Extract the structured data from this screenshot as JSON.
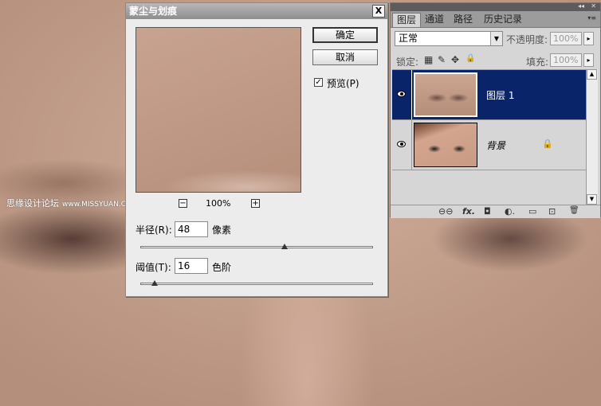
{
  "watermark": {
    "text": "思缘设计论坛",
    "url": "www.MISSYUAN.COM"
  },
  "dialog": {
    "title": "蒙尘与划痕",
    "close": "X",
    "ok": "确定",
    "cancel": "取消",
    "preview_checkbox": {
      "label": "预览(P)",
      "checked": true,
      "mark": "✓"
    },
    "zoom": {
      "minus": "−",
      "plus": "+",
      "level": "100%"
    },
    "radius": {
      "label": "半径(R):",
      "value": "48",
      "unit": "像素",
      "slider_fraction": 0.62
    },
    "threshold": {
      "label": "阈值(T):",
      "value": "16",
      "unit": "色阶",
      "slider_fraction": 0.06
    }
  },
  "panel": {
    "collapse_icon": "◂◂",
    "close_icon": "✕",
    "tabs": [
      "图层",
      "通道",
      "路径",
      "历史记录"
    ],
    "menu_icon": "▾≡",
    "blend_mode": "正常",
    "opacity_label": "不透明度:",
    "opacity_value": "100%",
    "lock_label": "锁定:",
    "fill_label": "填充:",
    "fill_value": "100%",
    "arrow": "▸",
    "dropdown_arrow": "▼",
    "layers": [
      {
        "name": "图层 1",
        "selected": true,
        "visible": true
      },
      {
        "name": "背景",
        "selected": false,
        "visible": true,
        "locked": true
      }
    ],
    "footer_icons": [
      "link-icon",
      "fx-icon",
      "mask-icon",
      "adjustment-icon",
      "group-icon",
      "new-layer-icon",
      "trash-icon"
    ],
    "footer_symbols": [
      "⊖⊖",
      "fx.",
      "◘",
      "◐.",
      "▭",
      "⊡",
      "🗑"
    ],
    "lock_symbols": [
      "▦",
      "✎",
      "✥",
      "🔒"
    ]
  }
}
